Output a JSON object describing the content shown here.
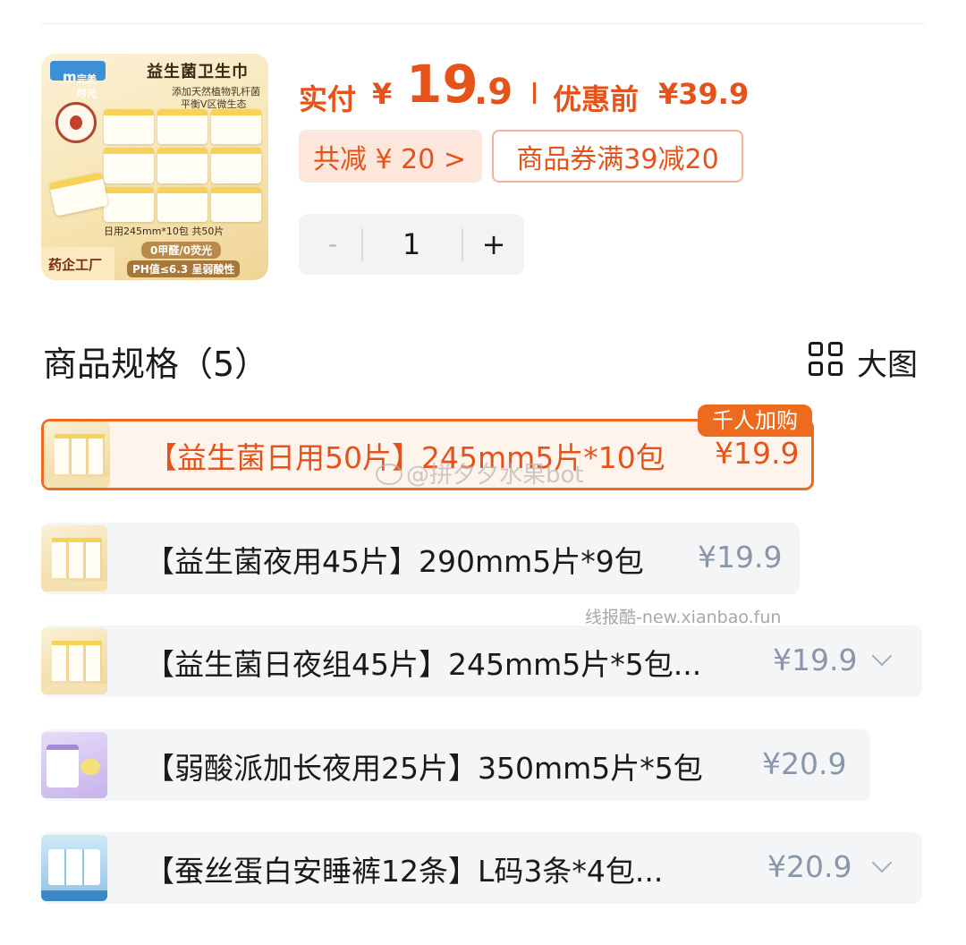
{
  "product": {
    "image_title": "益生菌卫生巾",
    "image_sub1": "添加天然植物乳杆菌",
    "image_sub2": "平衡V区微生态",
    "image_spec": "日用245mm*10包 共50片",
    "image_badge_left": "药企工厂",
    "image_badge_r1": "0甲醛/0荧光",
    "image_badge_r2": "PH值≤6.3 呈弱酸性",
    "logo_text": "完美时光"
  },
  "price": {
    "paid_label": "实付",
    "currency": "¥",
    "paid_int": "19",
    "paid_dec": ".9",
    "orig_label": "优惠前",
    "orig_value": "¥39.9",
    "accent_color": "#e6531a"
  },
  "discount": {
    "total_label": "共减 ¥ 20 >",
    "coupon_label": "商品券满39减20"
  },
  "quantity": {
    "minus": "-",
    "value": "1",
    "plus": "+"
  },
  "specs": {
    "title": "商品规格（5）",
    "view_toggle_label": "大图",
    "view_toggle_icon": "grid-icon",
    "hot_tag": "千人加购",
    "items": [
      {
        "label": "【益生菌日用50片】245mm5片*10包",
        "price": "¥19.9",
        "selected": true,
        "thumb": "yellow"
      },
      {
        "label": "【益生菌夜用45片】290mm5片*9包",
        "price": "¥19.9",
        "selected": false,
        "thumb": "yellow"
      },
      {
        "label": "【益生菌日夜组45片】245mm5片*5包...",
        "price": "¥19.9",
        "selected": false,
        "thumb": "yellow",
        "expandable": true
      },
      {
        "label": "【弱酸派加长夜用25片】350mm5片*5包",
        "price": "¥20.9",
        "selected": false,
        "thumb": "purple"
      },
      {
        "label": "【蚕丝蛋白安睡裤12条】L码3条*4包...",
        "price": "¥20.9",
        "selected": false,
        "thumb": "blue",
        "expandable": true
      }
    ]
  },
  "watermarks": {
    "weibo": "@拼夕夕水果bot",
    "site": "线报酷-new.xianbao.fun"
  }
}
